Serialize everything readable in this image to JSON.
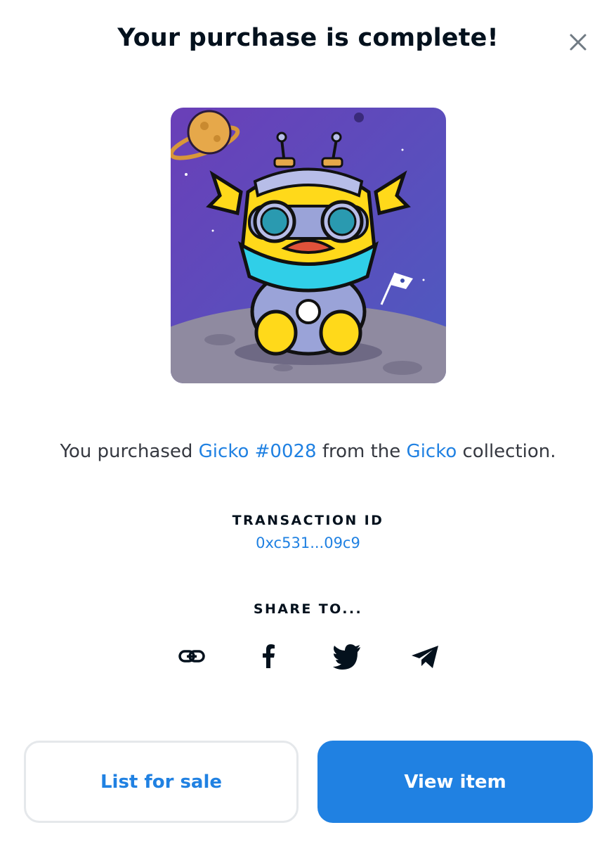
{
  "modal": {
    "title": "Your purchase is complete!",
    "close_icon": "close-icon"
  },
  "item": {
    "image_icon": "nft-gicko-image",
    "purchase_prefix": "You purchased ",
    "item_name": "Gicko #0028",
    "purchase_middle": " from the ",
    "collection_name": "Gicko",
    "purchase_suffix": " collection."
  },
  "transaction": {
    "label": "TRANSACTION ID",
    "id": "0xc531...09c9"
  },
  "share": {
    "label": "SHARE TO...",
    "icons": [
      "link-icon",
      "facebook-icon",
      "twitter-icon",
      "telegram-icon"
    ]
  },
  "actions": {
    "list_label": "List for sale",
    "view_label": "View item"
  },
  "colors": {
    "accent": "#2081e2",
    "text_dark": "#04111d",
    "text_body": "#353840",
    "border": "#e5e8eb"
  }
}
